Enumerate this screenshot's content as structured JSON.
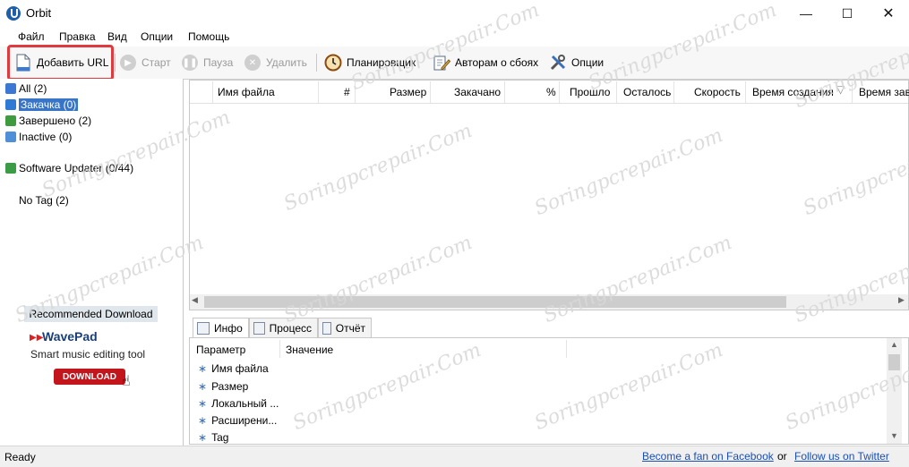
{
  "window": {
    "title": "Orbit"
  },
  "menu": [
    "Файл",
    "Правка",
    "Вид",
    "Опции",
    "Помощь"
  ],
  "toolbar": {
    "add_url": "Добавить URL",
    "start": "Старт",
    "pause": "Пауза",
    "delete": "Удалить",
    "scheduler": "Планировщик",
    "report_authors": "Авторам о сбоях",
    "options": "Опции"
  },
  "categories": [
    {
      "label": "All (2)",
      "color": "#3b78d4"
    },
    {
      "label": "Закачка (0)",
      "color": "#2e7bd6"
    },
    {
      "label": "Завершено (2)",
      "color": "#3e9c3e"
    },
    {
      "label": "Inactive (0)",
      "color": "#4f8fd8"
    },
    {
      "label": "Software Updater (0/44)",
      "color": "#3b9c45"
    },
    {
      "label": "No Tag (2)"
    }
  ],
  "ad": {
    "header": "Recommended Download",
    "title": "WavePad",
    "subtitle": "Smart music editing tool",
    "button": "DOWNLOAD"
  },
  "columns": [
    "Имя файла",
    "#",
    "Размер",
    "Закачано",
    "%",
    "Прошло",
    "Осталось",
    "Скорость",
    "Время создания",
    "Время зав"
  ],
  "tabs": [
    "Инфо",
    "Процесс",
    "Отчёт"
  ],
  "info": {
    "param_header": "Параметр",
    "value_header": "Значение",
    "rows": [
      "Имя файла",
      "Размер",
      "Локальный ...",
      "Расширени...",
      "Tag"
    ]
  },
  "status": {
    "text": "Ready",
    "facebook": "Become a fan on Facebook",
    "or": "or",
    "twitter": "Follow us on Twitter"
  },
  "watermark": "Soringpcrepair.Com"
}
